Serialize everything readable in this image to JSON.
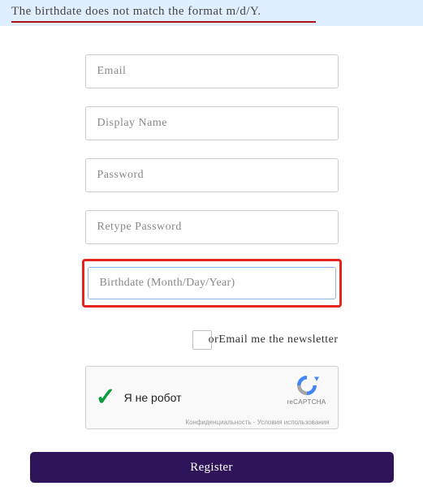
{
  "error": {
    "message": "The birthdate does not match the format m/d/Y."
  },
  "form": {
    "email": {
      "placeholder": "Email",
      "value": ""
    },
    "displayName": {
      "placeholder": "Display Name",
      "value": ""
    },
    "password": {
      "placeholder": "Password",
      "value": ""
    },
    "retypePassword": {
      "placeholder": "Retype Password",
      "value": ""
    },
    "birthdate": {
      "placeholder": "Birthdate (Month/Day/Year)",
      "value": ""
    },
    "newsletter": {
      "label": "orEmail me the newsletter",
      "checked": false
    },
    "recaptcha": {
      "label": "Я не робот",
      "brand": "reCAPTCHA",
      "terms": "Конфиденциальность - Условия использования"
    },
    "submit": {
      "label": "Register"
    }
  }
}
